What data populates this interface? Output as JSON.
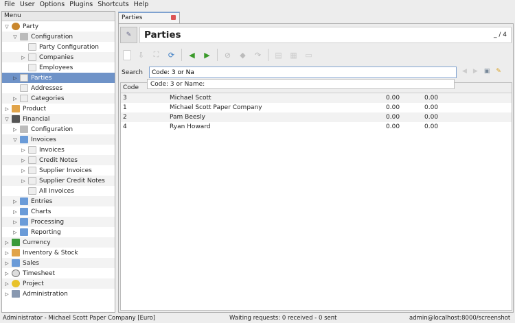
{
  "menubar": [
    "File",
    "User",
    "Options",
    "Plugins",
    "Shortcuts",
    "Help"
  ],
  "menu_header": "Menu",
  "tree": [
    {
      "label": "Party",
      "level": 0,
      "toggle": "open",
      "icon": "party"
    },
    {
      "label": "Configuration",
      "level": 1,
      "toggle": "open",
      "icon": "cart"
    },
    {
      "label": "Party Configuration",
      "level": 2,
      "toggle": "",
      "icon": "doc"
    },
    {
      "label": "Companies",
      "level": 2,
      "toggle": "closed",
      "icon": "doc"
    },
    {
      "label": "Employees",
      "level": 2,
      "toggle": "",
      "icon": "doc"
    },
    {
      "label": "Parties",
      "level": 1,
      "toggle": "closed",
      "icon": "doc",
      "selected": true
    },
    {
      "label": "Addresses",
      "level": 1,
      "toggle": "",
      "icon": "doc"
    },
    {
      "label": "Categories",
      "level": 1,
      "toggle": "closed",
      "icon": "doc"
    },
    {
      "label": "Product",
      "level": 0,
      "toggle": "closed",
      "icon": "box"
    },
    {
      "label": "Financial",
      "level": 0,
      "toggle": "open",
      "icon": "calc"
    },
    {
      "label": "Configuration",
      "level": 1,
      "toggle": "closed",
      "icon": "cart"
    },
    {
      "label": "Invoices",
      "level": 1,
      "toggle": "open",
      "icon": "folder"
    },
    {
      "label": "Invoices",
      "level": 2,
      "toggle": "closed",
      "icon": "doc"
    },
    {
      "label": "Credit Notes",
      "level": 2,
      "toggle": "closed",
      "icon": "doc"
    },
    {
      "label": "Supplier Invoices",
      "level": 2,
      "toggle": "closed",
      "icon": "doc"
    },
    {
      "label": "Supplier Credit Notes",
      "level": 2,
      "toggle": "closed",
      "icon": "doc"
    },
    {
      "label": "All Invoices",
      "level": 2,
      "toggle": "",
      "icon": "doc"
    },
    {
      "label": "Entries",
      "level": 1,
      "toggle": "closed",
      "icon": "folder"
    },
    {
      "label": "Charts",
      "level": 1,
      "toggle": "closed",
      "icon": "folder"
    },
    {
      "label": "Processing",
      "level": 1,
      "toggle": "closed",
      "icon": "folder"
    },
    {
      "label": "Reporting",
      "level": 1,
      "toggle": "closed",
      "icon": "folder"
    },
    {
      "label": "Currency",
      "level": 0,
      "toggle": "closed",
      "icon": "money"
    },
    {
      "label": "Inventory & Stock",
      "level": 0,
      "toggle": "closed",
      "icon": "box"
    },
    {
      "label": "Sales",
      "level": 0,
      "toggle": "closed",
      "icon": "folder"
    },
    {
      "label": "Timesheet",
      "level": 0,
      "toggle": "closed",
      "icon": "clock"
    },
    {
      "label": "Project",
      "level": 0,
      "toggle": "closed",
      "icon": "proj"
    },
    {
      "label": "Administration",
      "level": 0,
      "toggle": "closed",
      "icon": "tools"
    }
  ],
  "tab": {
    "label": "Parties"
  },
  "title": {
    "text": "Parties",
    "counter": "_ / 4"
  },
  "search": {
    "label": "Search",
    "value": "Code: 3 or Na",
    "suggestion": "Code: 3 or Name:"
  },
  "table": {
    "header_code": "Code",
    "rows": [
      {
        "code": "3",
        "name": "Michael Scott",
        "a": "0.00",
        "b": "0.00"
      },
      {
        "code": "1",
        "name": "Michael Scott Paper Company",
        "a": "0.00",
        "b": "0.00"
      },
      {
        "code": "2",
        "name": "Pam Beesly",
        "a": "0.00",
        "b": "0.00"
      },
      {
        "code": "4",
        "name": "Ryan Howard",
        "a": "0.00",
        "b": "0.00"
      }
    ]
  },
  "status": {
    "left": "Administrator - Michael Scott Paper Company [Euro]",
    "center": "Waiting requests: 0 received - 0 sent",
    "right": "admin@localhost:8000/screenshot"
  }
}
